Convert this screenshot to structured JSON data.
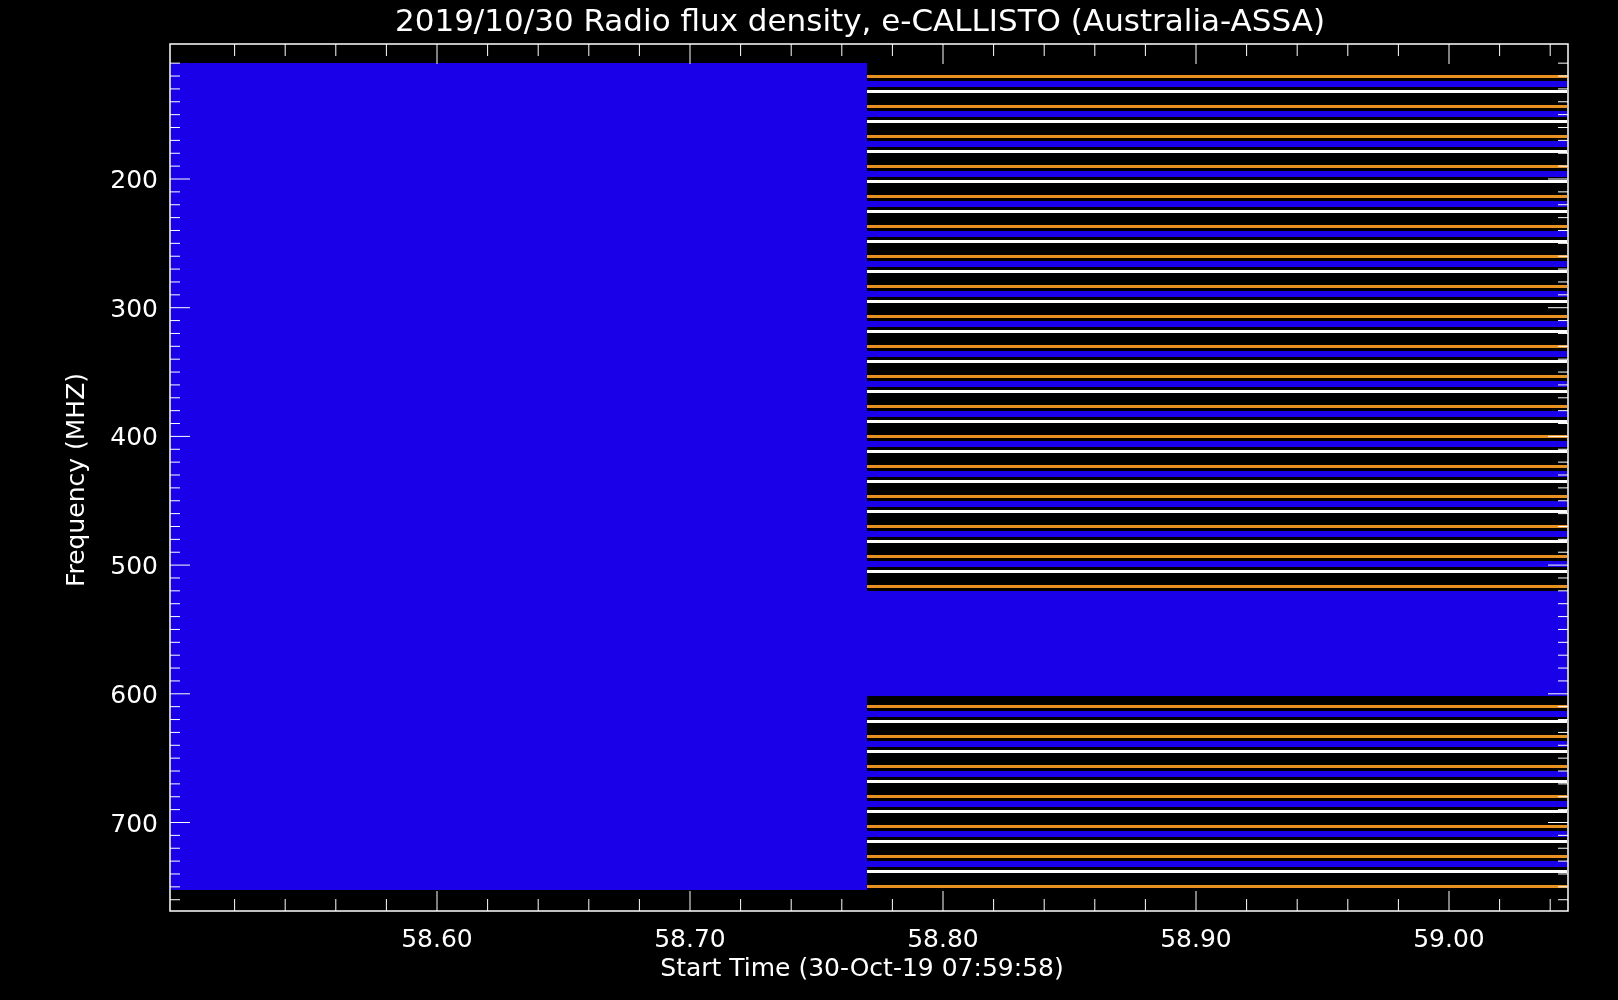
{
  "title": "2019/10/30  Radio flux density, e-CALLISTO (Australia-ASSA)",
  "y_axis": {
    "label": "Frequency (MHZ)",
    "ticks": [
      "200",
      "300",
      "400",
      "500",
      "600",
      "700"
    ]
  },
  "x_axis": {
    "label": "Start Time (30-Oct-19 07:59:58)",
    "ticks": [
      "58.60",
      "58.70",
      "58.80",
      "58.90",
      "59.00"
    ]
  }
}
